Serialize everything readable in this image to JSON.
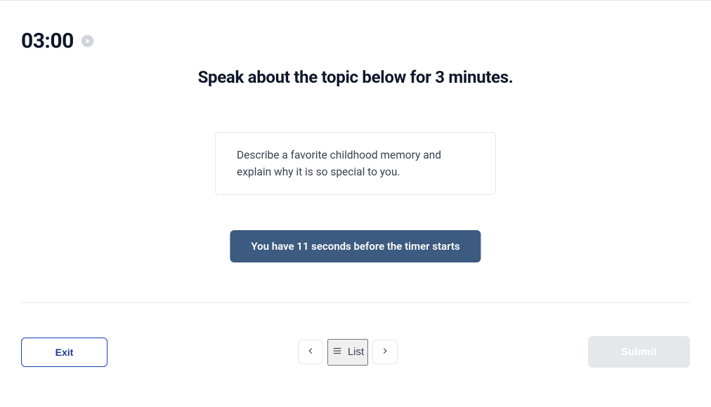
{
  "timer": {
    "display": "03:00"
  },
  "title": "Speak about the topic below for 3 minutes.",
  "prompt": {
    "text": "Describe a favorite childhood memory and explain why it is so special to you."
  },
  "countdown": {
    "message": "You have 11 seconds before the timer starts"
  },
  "footer": {
    "exit_label": "Exit",
    "list_label": "List",
    "submit_label": "Submit"
  }
}
